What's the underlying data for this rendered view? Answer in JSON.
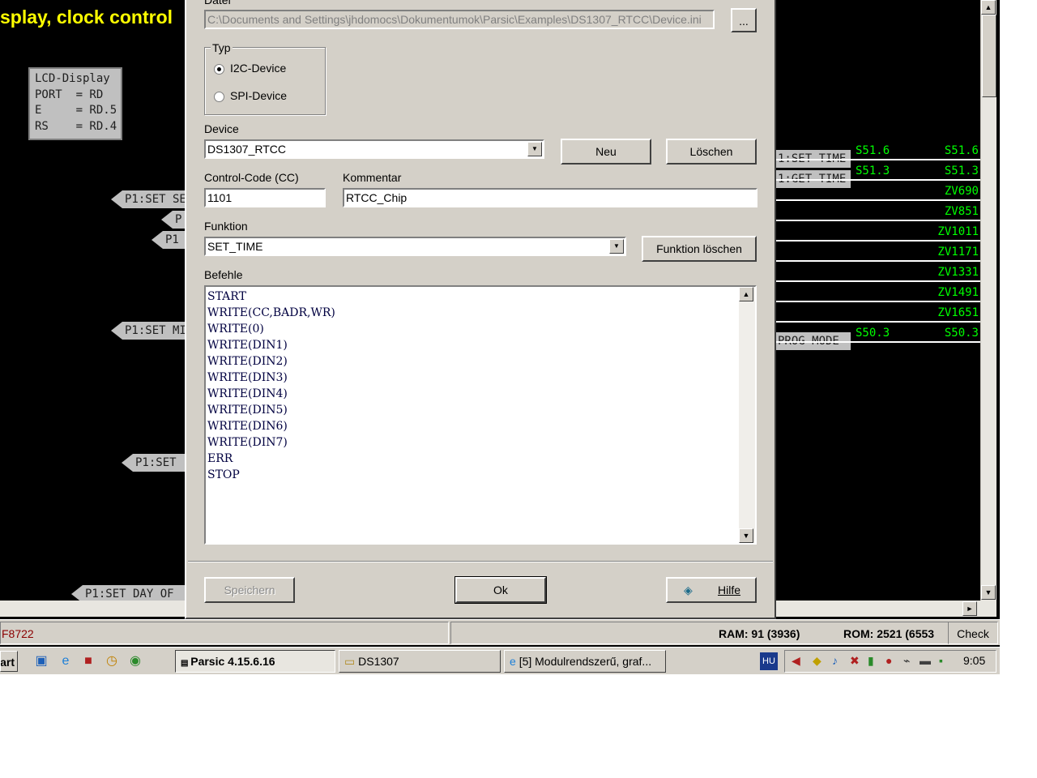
{
  "background": {
    "heading": "splay, clock control",
    "lcd_box": [
      "LCD-Display",
      "PORT  = RD",
      "E     = RD.5",
      "RS    = RD.4"
    ],
    "left_signals": [
      "P1:SET SE",
      "P",
      "P1",
      "P1:SET MI",
      "P1:SET",
      "P1:SET DAY OF"
    ],
    "right_signals": [
      "1:SET TIME",
      "1:GET TIME",
      "PROG MODE"
    ],
    "nets": [
      {
        "left": "S51.6",
        "right": "S51.6"
      },
      {
        "left": "S51.3",
        "right": "S51.3"
      },
      {
        "left": "",
        "right": "ZV690"
      },
      {
        "left": "",
        "right": "ZV851"
      },
      {
        "left": "",
        "right": "ZV1011"
      },
      {
        "left": "",
        "right": "ZV1171"
      },
      {
        "left": "",
        "right": "ZV1331"
      },
      {
        "left": "",
        "right": "ZV1491"
      },
      {
        "left": "",
        "right": "ZV1651"
      },
      {
        "left": "S50.3",
        "right": "S50.3"
      }
    ]
  },
  "status": {
    "left": "F8722",
    "ram": "RAM: 91 (3936)",
    "rom": "ROM: 2521 (6553",
    "check": "Check"
  },
  "taskbar": {
    "start": "art",
    "tasks": [
      "Parsic 4.15.6.16",
      "DS1307",
      "[5] Modulrendszerű, graf..."
    ],
    "lang": "HU",
    "clock": "9:05"
  },
  "dialog": {
    "file_label": "Datei",
    "file_path": "C:\\Documents and Settings\\jhdomocs\\Dokumentumok\\Parsic\\Examples\\DS1307_RTCC\\Device.ini",
    "browse_label": "...",
    "type_group": "Typ",
    "i2c_label": "I2C-Device",
    "spi_label": "SPI-Device",
    "device_label": "Device",
    "device_value": "DS1307_RTCC",
    "new_button": "Neu",
    "delete_button": "Löschen",
    "cc_label": "Control-Code (CC)",
    "cc_value": "1101",
    "comment_label": "Kommentar",
    "comment_value": "RTCC_Chip",
    "function_label": "Funktion",
    "function_value": "SET_TIME",
    "delete_function_button": "Funktion löschen",
    "commands_label": "Befehle",
    "commands": [
      "START",
      "WRITE(CC,BADR,WR)",
      "WRITE(0)",
      "WRITE(DIN1)",
      "WRITE(DIN2)",
      "WRITE(DIN3)",
      "WRITE(DIN4)",
      "WRITE(DIN5)",
      "WRITE(DIN6)",
      "WRITE(DIN7)",
      "ERR",
      "STOP"
    ],
    "save_button": "Speichern",
    "ok_button": "Ok",
    "help_button": "Hilfe"
  }
}
